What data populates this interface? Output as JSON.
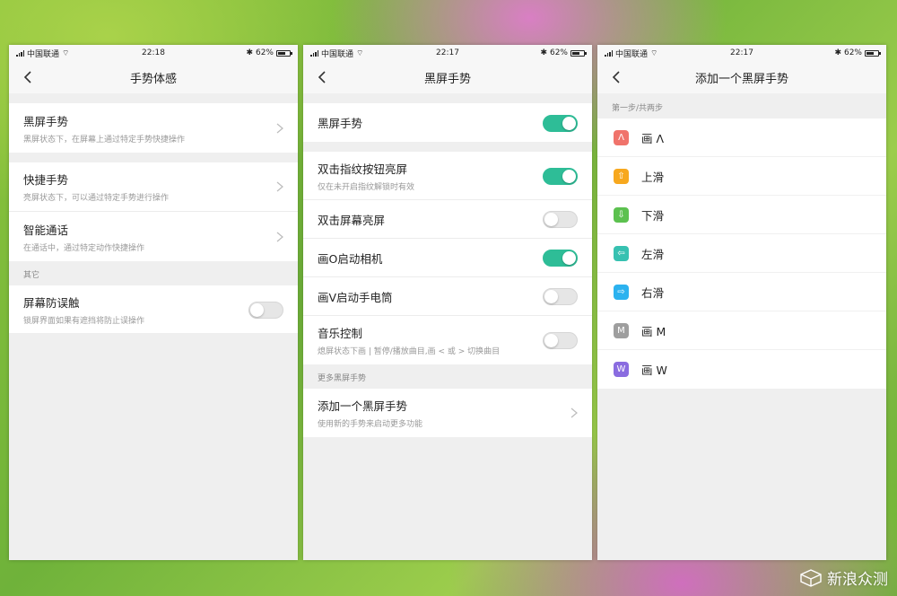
{
  "screens": [
    {
      "status": {
        "carrier": "中国联通",
        "time": "22:18",
        "battery": "62%"
      },
      "title": "手势体感",
      "groups": [
        {
          "rows": [
            {
              "title": "黑屏手势",
              "sub": "黑屏状态下，在屏幕上通过特定手势快捷操作"
            }
          ]
        },
        {
          "rows": [
            {
              "title": "快捷手势",
              "sub": "亮屏状态下，可以通过特定手势进行操作"
            },
            {
              "title": "智能通话",
              "sub": "在通话中，通过特定动作快捷操作"
            }
          ]
        }
      ],
      "section_other": "其它",
      "other_row": {
        "title": "屏幕防误触",
        "sub": "锁屏界面如果有遮挡将防止误操作",
        "toggle": false
      }
    },
    {
      "status": {
        "carrier": "中国联通",
        "time": "22:17",
        "battery": "62%"
      },
      "title": "黑屏手势",
      "master": {
        "title": "黑屏手势",
        "toggle": true
      },
      "rows": [
        {
          "title": "双击指纹按钮亮屏",
          "sub": "仅在未开启指纹解锁时有效",
          "toggle": true
        },
        {
          "title": "双击屏幕亮屏",
          "toggle": false
        },
        {
          "title": "画O启动相机",
          "toggle": true
        },
        {
          "title": "画V启动手电筒",
          "toggle": false
        },
        {
          "title": "音乐控制",
          "sub": "熄屏状态下画 | 暂停/播放曲目,画 < 或 > 切换曲目",
          "toggle": false
        }
      ],
      "section_more": "更多黑屏手势",
      "add_row": {
        "title": "添加一个黑屏手势",
        "sub": "使用新的手势来启动更多功能"
      }
    },
    {
      "status": {
        "carrier": "中国联通",
        "time": "22:17",
        "battery": "62%"
      },
      "title": "添加一个黑屏手势",
      "step": "第一步/共两步",
      "gestures": [
        {
          "label": "画 Λ",
          "icon": "caret-up-icon",
          "glyph": "Λ",
          "color": "#f0736b"
        },
        {
          "label": "上滑",
          "icon": "arrow-up-icon",
          "glyph": "⇧",
          "color": "#f7a81e"
        },
        {
          "label": "下滑",
          "icon": "arrow-down-icon",
          "glyph": "⇩",
          "color": "#5cc14f"
        },
        {
          "label": "左滑",
          "icon": "arrow-left-icon",
          "glyph": "⇦",
          "color": "#37c1b1"
        },
        {
          "label": "右滑",
          "icon": "arrow-right-icon",
          "glyph": "⇨",
          "color": "#2cb2ef"
        },
        {
          "label": "画 M",
          "icon": "letter-m-icon",
          "glyph": "M",
          "color": "#9e9e9e"
        },
        {
          "label": "画 W",
          "icon": "letter-w-icon",
          "glyph": "W",
          "color": "#8a6ce0"
        }
      ]
    }
  ],
  "watermark": "新浪众测",
  "colors": {
    "accent": "#2ebd97",
    "background": "#efefef"
  }
}
